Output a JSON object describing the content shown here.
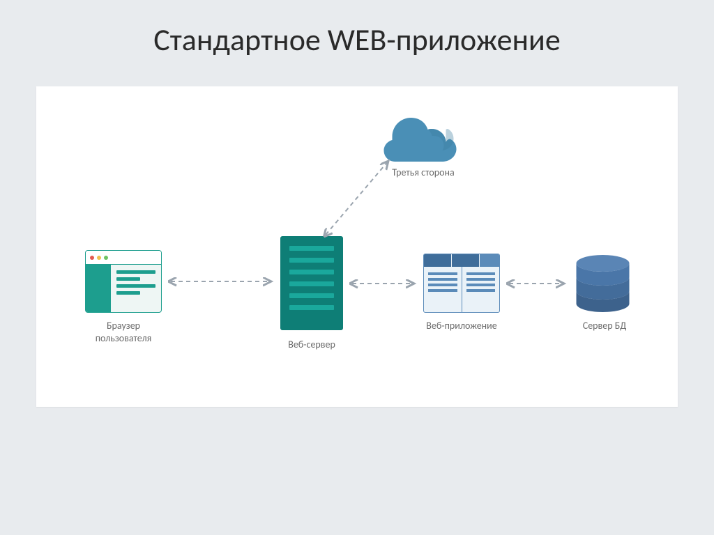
{
  "title": "Стандартное WEB-приложение",
  "nodes": {
    "browser": {
      "label_line1": "Браузер",
      "label_line2": "пользователя"
    },
    "server": {
      "label": "Веб-сервер"
    },
    "cloud": {
      "label": "Третья сторона"
    },
    "webapp": {
      "label": "Веб-приложение"
    },
    "db": {
      "label": "Сервер БД"
    }
  },
  "colors": {
    "teal": "#0e7e76",
    "teal_light": "#1d9e8e",
    "blue": "#5b8bb9",
    "blue_dark": "#3f6d9a",
    "db_blue": "#4a76a8",
    "cloud_blue": "#4a8fb6",
    "arrow": "#9aa4ae"
  },
  "connections": [
    {
      "from": "browser",
      "to": "server",
      "bidirectional": true
    },
    {
      "from": "server",
      "to": "webapp",
      "bidirectional": true
    },
    {
      "from": "webapp",
      "to": "db",
      "bidirectional": true
    },
    {
      "from": "server",
      "to": "cloud",
      "bidirectional": true
    }
  ]
}
